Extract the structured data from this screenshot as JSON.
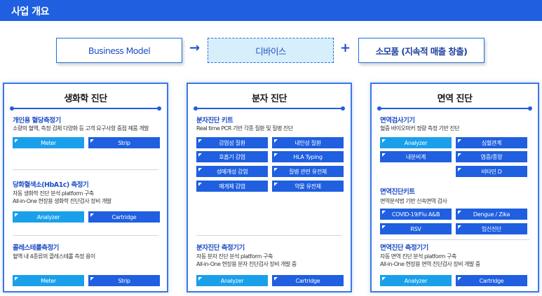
{
  "page": {
    "title": "사업 개요"
  },
  "header": {
    "business_model": "Business Model",
    "device": "디바이스",
    "arrow": "→",
    "plus": "+",
    "consumables": "소모품 (지속적 매출 창출)"
  },
  "columns": {
    "biochem": {
      "title": "생화학 진단",
      "s1": {
        "title": "개인용 혈당측정기",
        "desc": [
          "소량의 혈액, 측정 검체 다양화 등 고객 요구사항 중점 제품 개발"
        ],
        "tags": [
          "Meter",
          "Strip"
        ]
      },
      "s2": {
        "title": "당화혈색소(HbA1c) 측정기",
        "desc": [
          "자동 생화학 진단 분석 platform 구축",
          "All-in-One 현장용 생화학 진단검사 장비 개발"
        ],
        "tags": [
          "Analyzer",
          "Cartridge"
        ]
      },
      "s3": {
        "title": "콜레스테롤측정기",
        "desc": [
          "혈액 내 4종류의 콜레스테롤 측정 용이"
        ],
        "tags": [
          "Meter",
          "Strip"
        ]
      }
    },
    "molecular": {
      "title": "분자 진단",
      "s1": {
        "title": "분자진단 키트",
        "desc": [
          "Real time PCR 기반 각종 질환 및 질병 진단"
        ],
        "tags": [
          "감염성 질환",
          "내인성 질환",
          "호흡기 감염",
          "HLA Typing",
          "성매개성 감염",
          "질병 관련 유전체",
          "매개체 감염",
          "약물 유전체"
        ]
      },
      "s2": {
        "title": "분자진단 측정기기",
        "desc": [
          "자동 분자 진단 분석 platform 구축",
          "All-in-One 현장용 분자 진단검사 장비 개발 중"
        ],
        "tags": [
          "Analyzer",
          "Cartridge"
        ]
      }
    },
    "immune": {
      "title": "면역 진단",
      "s1": {
        "title": "면역검사기기",
        "desc": [
          "혈중 바이오마커 정량 측정 기반 진단"
        ],
        "tags": [
          "Analyzer",
          "심혈관계",
          "내분비계",
          "염증/종양",
          "비타민 D"
        ]
      },
      "s2": {
        "title": "면역진단키트",
        "desc": [
          "면역분석법 기반 신속면역 검사"
        ],
        "tags": [
          "COVID-19/Flu A&B",
          "Dengue / Zika",
          "RSV",
          "임신진단"
        ]
      },
      "s3": {
        "title": "면역진단 측정기기",
        "desc": [
          "자동 면역 진단 분석 platform 구축",
          "All-in-One 현장용 면역 진단검사 장비 개발 중"
        ],
        "tags": [
          "Analyzer",
          "Cartridge"
        ]
      }
    }
  }
}
